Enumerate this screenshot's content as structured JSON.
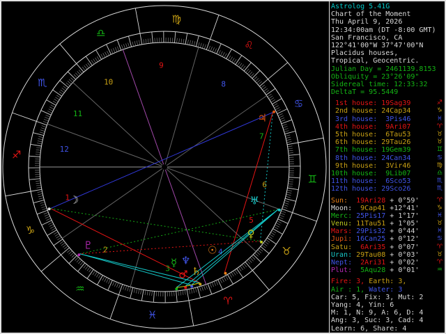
{
  "palette": {
    "white": "#d8d8d8",
    "cyan": "#00c8c8",
    "green": "#14b414",
    "fire": "#e41414",
    "earth": "#c8a014",
    "air": "#14b414",
    "water": "#4054e8",
    "gray": "#787878"
  },
  "sidebar": {
    "header": {
      "app_version": "Astrolog 5.41G",
      "chart_title": "Chart of the Moment",
      "date": "Thu April 9, 2026",
      "time": "12:34:00am (DT -8:00 GMT)",
      "location_name": "San Francisco, CA",
      "coordinates": "122°41'00\"W 37°47'00\"N",
      "house_system": "Placidus houses,",
      "zodiac_type": "Tropical, Geocentric.",
      "julian_day": "Julian Day = 2461139.8153",
      "obliquity": "Obliquity = 23°26'09\"",
      "sidereal_time": "Sidereal time: 12:33:32",
      "delta_t": "DeltaT = 95.5449"
    },
    "houses": [
      {
        "label": "1st house:",
        "value": "19Sag39",
        "glyph": "♐",
        "element": "fire",
        "lon": 259.65
      },
      {
        "label": "2nd house:",
        "value": "24Cap34",
        "glyph": "♑",
        "element": "earth",
        "lon": 294.5667
      },
      {
        "label": "3rd house:",
        "value": "3Pis46",
        "glyph": "♓",
        "element": "water",
        "lon": 333.7667
      },
      {
        "label": "4th house:",
        "value": "9Ari07",
        "glyph": "♈",
        "element": "fire",
        "lon": 9.1167
      },
      {
        "label": "5th house:",
        "value": "6Tau53",
        "glyph": "♉",
        "element": "earth",
        "lon": 36.8833
      },
      {
        "label": "6th house:",
        "value": "29Tau26",
        "glyph": "♉",
        "element": "earth",
        "lon": 59.4333
      },
      {
        "label": "7th house:",
        "value": "19Gem39",
        "glyph": "♊",
        "element": "air",
        "lon": 79.65
      },
      {
        "label": "8th house:",
        "value": "24Can34",
        "glyph": "♋",
        "element": "water",
        "lon": 114.5667
      },
      {
        "label": "9th house:",
        "value": "3Vir46",
        "glyph": "♍",
        "element": "earth",
        "lon": 153.7667
      },
      {
        "label": "10th house:",
        "value": "9Lib07",
        "glyph": "♎",
        "element": "air",
        "lon": 189.1167
      },
      {
        "label": "11th house:",
        "value": "6Sco53",
        "glyph": "♏",
        "element": "water",
        "lon": 216.8833
      },
      {
        "label": "12th house:",
        "value": "29Sco26",
        "glyph": "♏",
        "element": "water",
        "lon": 239.4333
      }
    ],
    "planets": [
      {
        "name": "sun",
        "label": "Sun:",
        "value": "19Ari28",
        "speed": "+ 0°59'",
        "glyph": "☉",
        "sign_glyph": "♈",
        "element": "fire",
        "lon": 19.4667
      },
      {
        "name": "moon",
        "label": "Moon:",
        "value": "9Cap41",
        "speed": "+12°41'",
        "glyph": "☽",
        "sign_glyph": "♑",
        "element": "earth",
        "lon": 279.6833
      },
      {
        "name": "mercury",
        "label": "Merc:",
        "value": "25Pis17",
        "speed": "+ 1°17'",
        "glyph": "☿",
        "sign_glyph": "♓",
        "element": "water",
        "lon": 355.2833
      },
      {
        "name": "venus",
        "label": "Venu:",
        "value": "11Tau51",
        "speed": "+ 1°05'",
        "glyph": "♀",
        "sign_glyph": "♉",
        "element": "earth",
        "lon": 41.85
      },
      {
        "name": "mars",
        "label": "Mars:",
        "value": "29Pis32",
        "speed": "+ 0°44'",
        "glyph": "♂",
        "sign_glyph": "♓",
        "element": "water",
        "lon": 359.5333
      },
      {
        "name": "jupiter",
        "label": "Jupi:",
        "value": "16Can25",
        "speed": "+ 0°12'",
        "glyph": "♃",
        "sign_glyph": "♋",
        "element": "water",
        "lon": 106.4167
      },
      {
        "name": "saturn",
        "label": "Satu:",
        "value": "6Ari35",
        "speed": "+ 0°07'",
        "glyph": "♄",
        "sign_glyph": "♈",
        "element": "fire",
        "lon": 6.5833
      },
      {
        "name": "uranus",
        "label": "Uran:",
        "value": "29Tau08",
        "speed": "+ 0°03'",
        "glyph": "♅",
        "sign_glyph": "♉",
        "element": "earth",
        "lon": 59.1333
      },
      {
        "name": "neptune",
        "label": "Nept:",
        "value": "2Ari31",
        "speed": "+ 0°02'",
        "glyph": "♆",
        "sign_glyph": "♈",
        "element": "fire",
        "lon": 2.5167
      },
      {
        "name": "pluto",
        "label": "Plut:",
        "value": "5Aqu28",
        "speed": "+ 0°01'",
        "glyph": "♇",
        "sign_glyph": "♒",
        "element": "air",
        "lon": 305.4667
      }
    ],
    "summary": [
      [
        {
          "text": "Fire: 3, ",
          "color": "fire"
        },
        {
          "text": "Earth: 3,",
          "color": "earth"
        }
      ],
      [
        {
          "text": "Air : 1, ",
          "color": "air"
        },
        {
          "text": "Water: 3",
          "color": "water"
        }
      ],
      [
        {
          "text": "Car: 5, Fix: 3, Mut: 2",
          "color": "white"
        }
      ],
      [
        {
          "text": "Yang: 4, Yin: 6",
          "color": "white"
        }
      ],
      [
        {
          "text": "M: 1, N: 9, A: 6, D: 4",
          "color": "white"
        }
      ],
      [
        {
          "text": "Ang: 3, Suc: 3, Cad: 4",
          "color": "white"
        }
      ],
      [
        {
          "text": "Learn: 6, Share: 4",
          "color": "white"
        }
      ]
    ]
  },
  "chart_data": {
    "type": "astrology-wheel",
    "ascendant_lon": 259.65,
    "signs": [
      {
        "name": "Aries",
        "glyph": "♈",
        "element": "fire"
      },
      {
        "name": "Taurus",
        "glyph": "♉",
        "element": "earth"
      },
      {
        "name": "Gemini",
        "glyph": "♊",
        "element": "air"
      },
      {
        "name": "Cancer",
        "glyph": "♋",
        "element": "water"
      },
      {
        "name": "Leo",
        "glyph": "♌",
        "element": "fire"
      },
      {
        "name": "Virgo",
        "glyph": "♍",
        "element": "earth"
      },
      {
        "name": "Libra",
        "glyph": "♎",
        "element": "air"
      },
      {
        "name": "Scorpio",
        "glyph": "♏",
        "element": "water"
      },
      {
        "name": "Sagittarius",
        "glyph": "♐",
        "element": "fire"
      },
      {
        "name": "Capricorn",
        "glyph": "♑",
        "element": "earth"
      },
      {
        "name": "Aquarius",
        "glyph": "♒",
        "element": "air"
      },
      {
        "name": "Pisces",
        "glyph": "♓",
        "element": "water"
      }
    ],
    "planet_colors": {
      "sun": "#e88018",
      "moon": "#dcdcdc",
      "mercury": "#16b416",
      "venus": "#bcc81e",
      "mars": "#e41414",
      "jupiter": "#e05414",
      "saturn": "#c8a014",
      "uranus": "#18c8c8",
      "neptune": "#4054e8",
      "pluto": "#b428b4"
    },
    "aspect_colors": {
      "con": "#c8c814",
      "sex": "#14c8c8",
      "squ": "#e41414",
      "tri": "#14a814",
      "opp": "#3038d8"
    },
    "aspects": [
      [
        1,
        5,
        "opp",
        0
      ],
      [
        0,
        5,
        "squ",
        0
      ],
      [
        1,
        6,
        "squ",
        0
      ],
      [
        3,
        9,
        "squ",
        1
      ],
      [
        1,
        3,
        "tri",
        1
      ],
      [
        7,
        9,
        "tri",
        1
      ],
      [
        2,
        7,
        "sex",
        0
      ],
      [
        4,
        7,
        "sex",
        0
      ],
      [
        6,
        9,
        "sex",
        0
      ],
      [
        8,
        9,
        "sex",
        0
      ],
      [
        7,
        8,
        "sex",
        0
      ],
      [
        3,
        5,
        "sex",
        1
      ],
      [
        2,
        4,
        "con",
        0
      ],
      [
        4,
        8,
        "con",
        0
      ],
      [
        6,
        8,
        "con",
        0
      ],
      [
        4,
        6,
        "con",
        1
      ]
    ]
  }
}
